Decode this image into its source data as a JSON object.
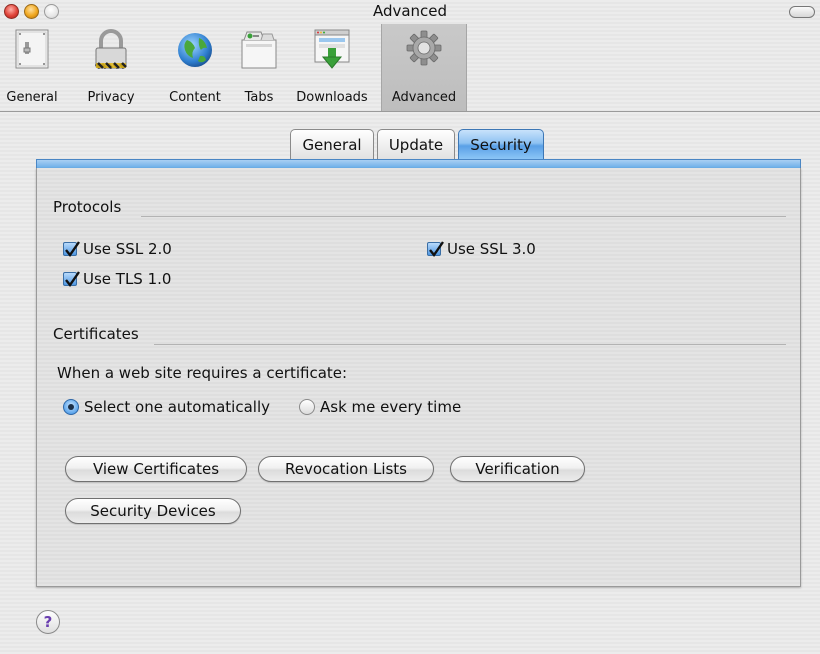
{
  "window": {
    "title": "Advanced"
  },
  "toolbar": {
    "items": [
      {
        "label": "General",
        "icon": "general-switch-icon"
      },
      {
        "label": "Privacy",
        "icon": "lock-icon"
      },
      {
        "label": "Content",
        "icon": "globe-icon"
      },
      {
        "label": "Tabs",
        "icon": "tabs-icon"
      },
      {
        "label": "Downloads",
        "icon": "downloads-icon"
      },
      {
        "label": "Advanced",
        "icon": "gear-icon",
        "selected": true
      }
    ]
  },
  "tabs": [
    {
      "label": "General",
      "active": false
    },
    {
      "label": "Update",
      "active": false
    },
    {
      "label": "Security",
      "active": true
    }
  ],
  "protocols": {
    "title": "Protocols",
    "ssl2": {
      "label": "Use SSL 2.0",
      "checked": true
    },
    "ssl3": {
      "label": "Use SSL 3.0",
      "checked": true
    },
    "tls1": {
      "label": "Use TLS 1.0",
      "checked": true
    }
  },
  "certificates": {
    "title": "Certificates",
    "prompt": "When a web site requires a certificate:",
    "radio_auto": {
      "label": "Select one automatically",
      "selected": true
    },
    "radio_ask": {
      "label": "Ask me every time",
      "selected": false
    },
    "buttons": {
      "view": "View Certificates",
      "revocation": "Revocation Lists",
      "verification": "Verification",
      "devices": "Security Devices"
    }
  },
  "help": {
    "label": "?"
  },
  "colors": {
    "accent": "#5aa0e6",
    "panel": "#e4e4e4",
    "help_glyph": "#6a3fb0"
  }
}
